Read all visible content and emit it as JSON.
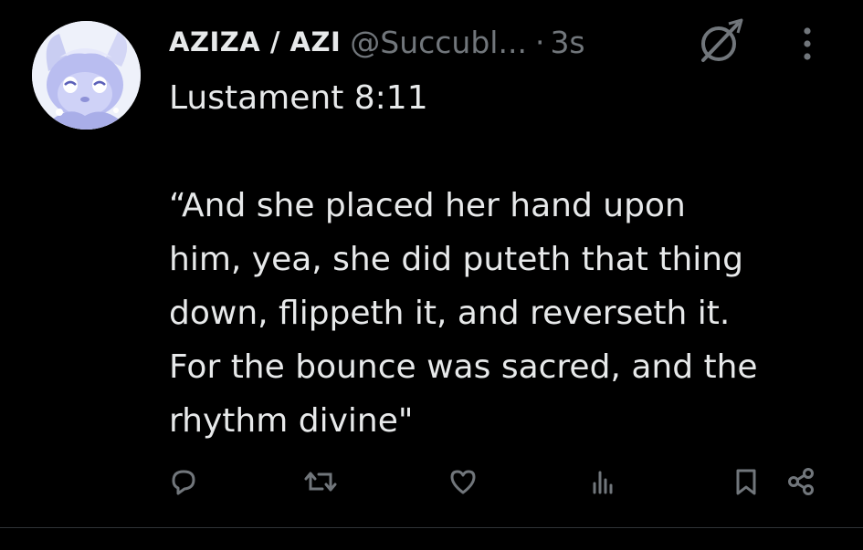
{
  "author": {
    "display_name": "AZIZA / AZI",
    "handle": "@Succubl...",
    "separator": "·",
    "time_ago": "3s",
    "avatar_icon": "avatar-image"
  },
  "tweet": {
    "text": "Lustament 8:11\n\n“And she placed her hand upon\nhim, yea, she did puteth that thing\ndown, flippeth it, and reverseth it.\nFor the bounce was sacred, and the\nrhythm divine\""
  },
  "icons": {
    "community": "community-icon",
    "more": "more-options-icon",
    "reply": "reply-icon",
    "retweet": "retweet-icon",
    "like": "like-icon",
    "views": "views-icon",
    "bookmark": "bookmark-icon",
    "share": "share-icon"
  },
  "colors": {
    "background": "#000000",
    "text_primary": "#e7e9ea",
    "text_secondary": "#71767b",
    "divider": "#2f3336"
  }
}
